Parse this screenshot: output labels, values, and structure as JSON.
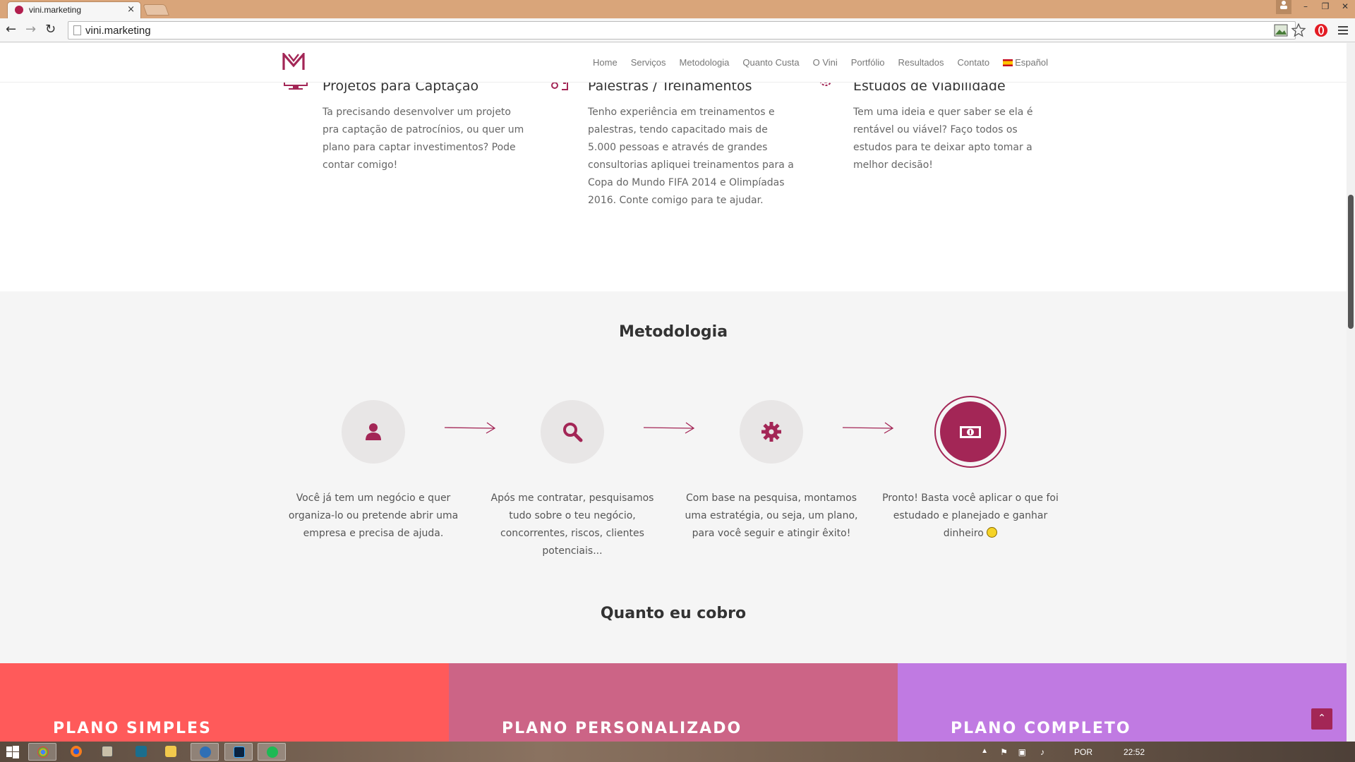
{
  "browser": {
    "tab_title": "vini.marketing",
    "tab_close": "×",
    "url": "vini.marketing",
    "controls": {
      "minimize": "–",
      "restore": "❐",
      "close": "✕"
    },
    "nav": {
      "back": "←",
      "forward": "→",
      "reload": "↻"
    }
  },
  "site": {
    "nav": [
      "Home",
      "Serviços",
      "Metodologia",
      "Quanto Custa",
      "O Vini",
      "Portfólio",
      "Resultados",
      "Contato"
    ],
    "language": "Español",
    "services": [
      {
        "title": "Projetos para Captação",
        "text": "Ta precisando desenvolver um projeto pra captação de patrocínios, ou quer um plano para captar investimentos? Pode contar comigo!"
      },
      {
        "title": "Palestras / Treinamentos",
        "text": "Tenho experiência em treinamentos e palestras, tendo capacitado mais de 5.000 pessoas e através de grandes consultorias apliquei treinamentos para a Copa do Mundo FIFA 2014 e Olimpíadas 2016. Conte comigo para te ajudar."
      },
      {
        "title": "Estudos de Viabilidade",
        "text": "Tem uma ideia e quer saber se ela é rentável ou viável? Faço todos os estudos para te deixar apto tomar a melhor decisão!"
      }
    ],
    "methodology": {
      "title": "Metodologia",
      "steps": [
        {
          "icon": "user-icon",
          "text": "Você já tem um negócio e quer organiza-lo ou pretende abrir uma empresa e precisa de ajuda."
        },
        {
          "icon": "search-icon",
          "text": "Após me contratar, pesquisamos tudo sobre o teu negócio, concorrentes, riscos, clientes potenciais..."
        },
        {
          "icon": "gear-icon",
          "text": "Com base na pesquisa, montamos uma estratégia, ou seja, um plano, para você seguir e atingir êxito!"
        },
        {
          "icon": "money-icon",
          "text": "Pronto! Basta você aplicar o que foi estudado e planejado e ganhar dinheiro"
        }
      ]
    },
    "pricing": {
      "title": "Quanto eu cobro",
      "plans": [
        {
          "name": "PLANO SIMPLES",
          "color": "#ff5a5a"
        },
        {
          "name": "PLANO PERSONALIZADO",
          "color": "#cc6486"
        },
        {
          "name": "PLANO COMPLETO",
          "color": "#c07ae2"
        }
      ]
    },
    "back_to_top": "⌃",
    "accent": "#a32656"
  },
  "taskbar": {
    "language": "POR",
    "time": "22:52"
  }
}
